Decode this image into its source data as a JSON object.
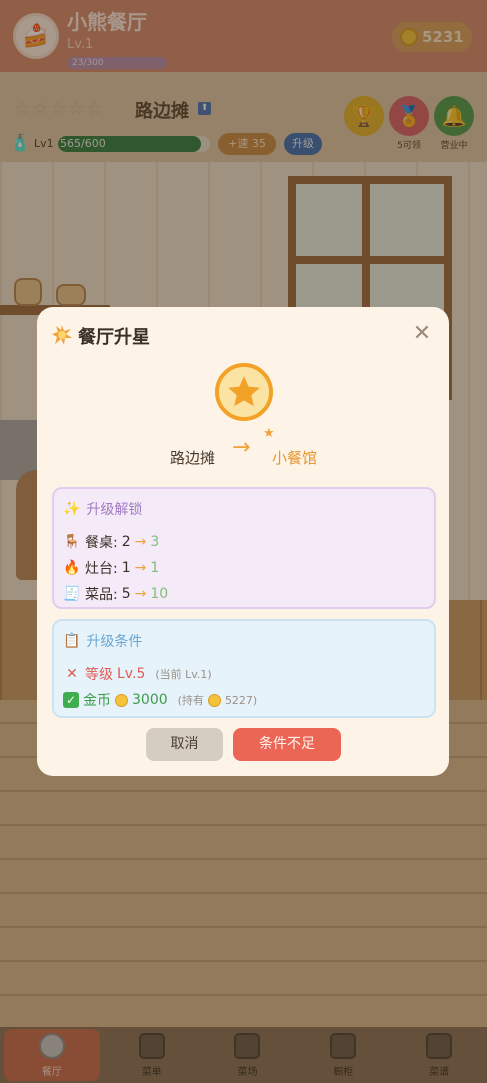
{
  "hud": {
    "shop_name": "小熊餐厅",
    "level": "Lv.1",
    "xp_text": "23/300",
    "coins": "5231"
  },
  "stage": {
    "stars": "☆☆☆☆☆",
    "name": "路边摊",
    "lv_label": "Lv1",
    "progress": 0.94,
    "progress_text": "565/600",
    "speed_label": "+速 35",
    "upgrade_label": "升级",
    "buttons": [
      {
        "icon": "trophy-icon",
        "label": ""
      },
      {
        "icon": "medal-icon",
        "label": "5可领"
      },
      {
        "icon": "bell-icon",
        "label": "营业中"
      }
    ]
  },
  "modal": {
    "title": "餐厅升星",
    "from_name": "路边摊",
    "to_name": "小餐馆",
    "unlock": {
      "title": "升级解锁",
      "rows": [
        {
          "icon": "table-icon",
          "label": "餐桌:",
          "old": "2",
          "new": "3"
        },
        {
          "icon": "fire-icon",
          "label": "灶台:",
          "old": "1",
          "new": "1"
        },
        {
          "icon": "menu-icon",
          "label": "菜品:",
          "old": "5",
          "new": "10"
        }
      ]
    },
    "conditions": {
      "title": "升级条件",
      "level_label": "等级",
      "level_required": "Lv.5",
      "level_hint": "(当前 Lv.1)",
      "coin_label": "金币",
      "coin_required": "3000",
      "coin_hint_prefix": "(持有",
      "coin_hint_value": "5227)"
    },
    "cancel_label": "取消",
    "confirm_label": "条件不足"
  },
  "nav": [
    {
      "icon": "restaurant-icon",
      "label": "餐厅",
      "active": true
    },
    {
      "icon": "menu-icon",
      "label": "菜单",
      "active": false
    },
    {
      "icon": "market-icon",
      "label": "菜场",
      "active": false
    },
    {
      "icon": "cabinet-icon",
      "label": "橱柜",
      "active": false
    },
    {
      "icon": "recipe-book-icon",
      "label": "菜谱",
      "active": false
    }
  ],
  "colors": {
    "accent": "#f0a23a",
    "danger": "#ec6655",
    "success": "#3f9b4c",
    "unlock_purple": "#a07cc2",
    "condition_blue": "#6ba7d4"
  }
}
